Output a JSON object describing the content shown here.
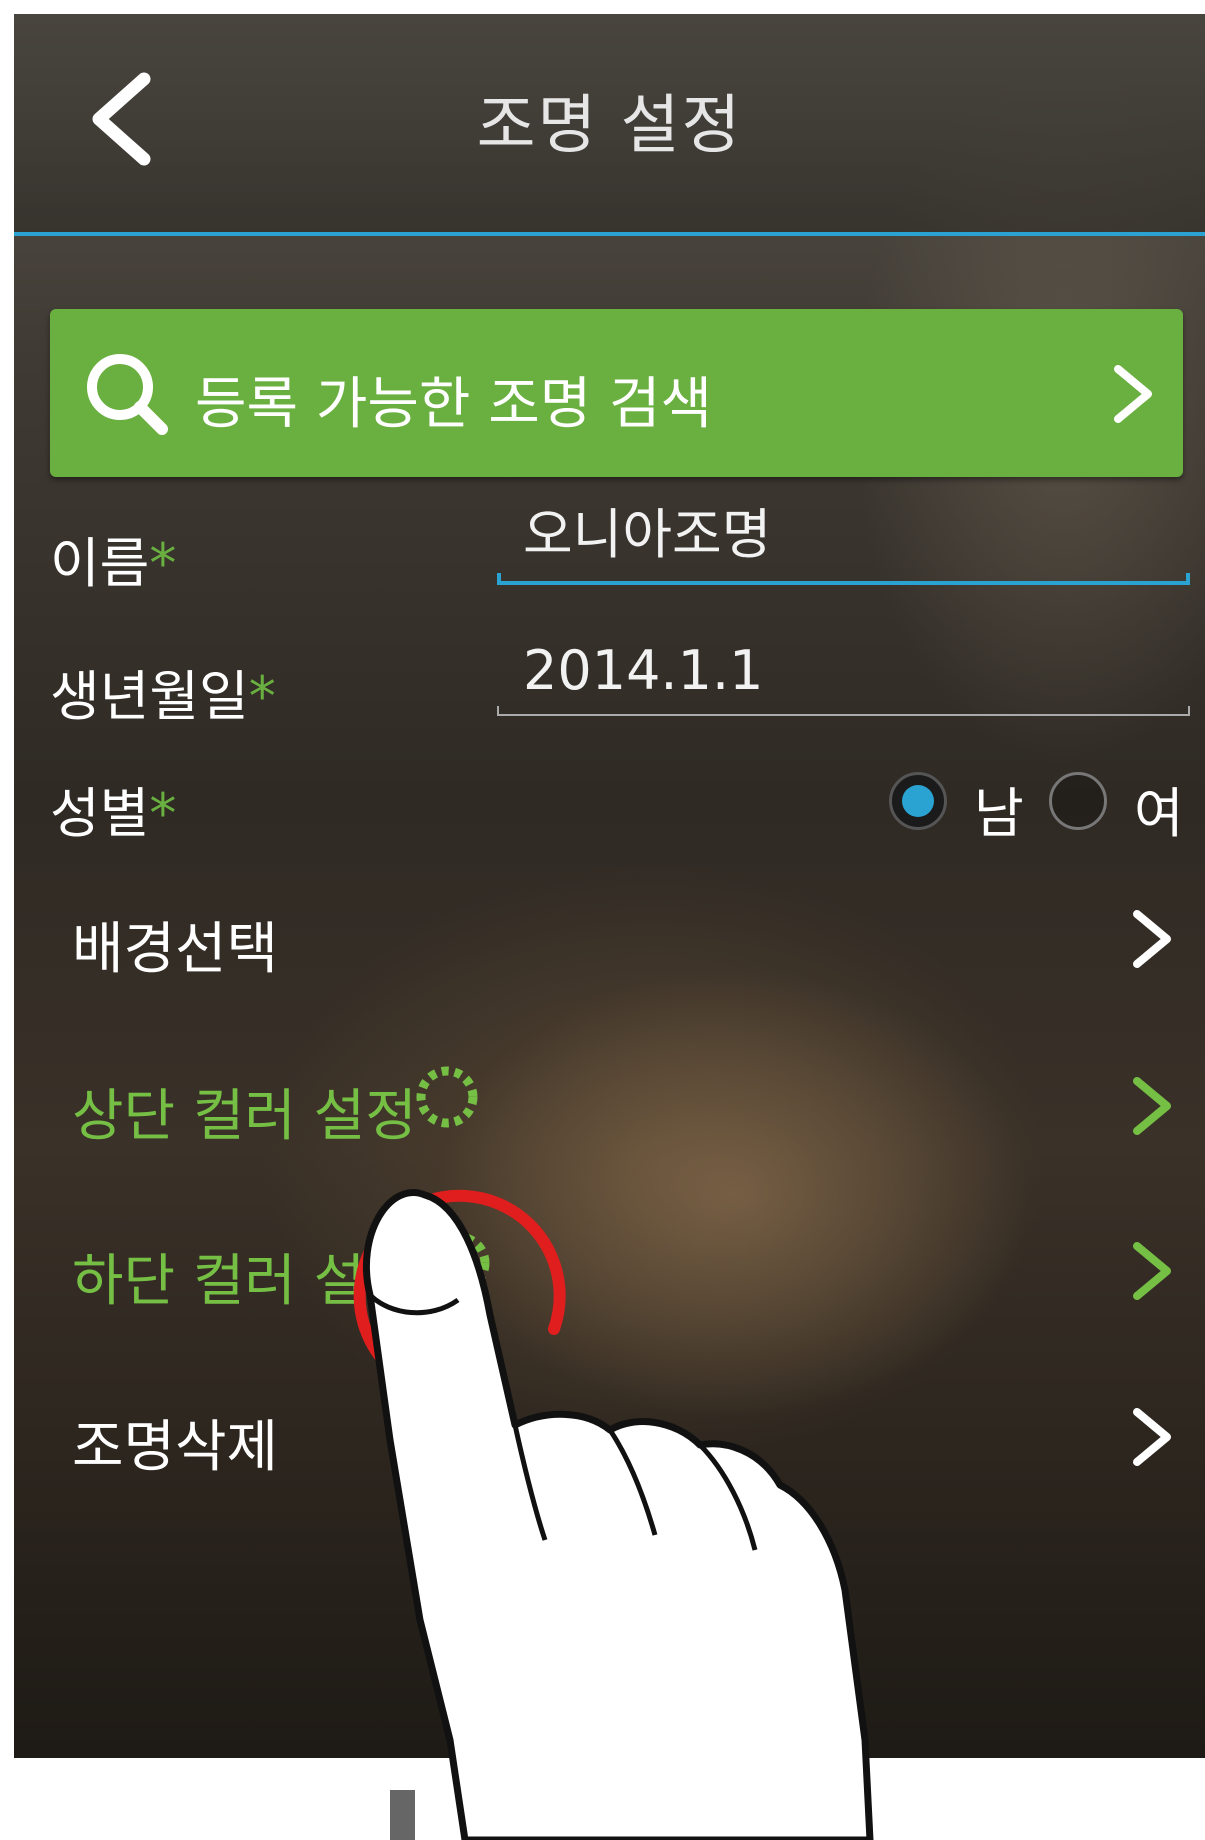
{
  "header": {
    "title": "조명 설정",
    "back_icon": "chevron-left-icon"
  },
  "search": {
    "label": "등록 가능한 조명 검색",
    "icon": "search-icon",
    "chevron": "chevron-right-icon"
  },
  "form": {
    "name_label": "이름",
    "name_value": "오니아조명",
    "birth_label": "생년월일",
    "birth_value": "2014.1.1",
    "gender_label": "성별",
    "gender_male": "남",
    "gender_female": "여",
    "gender_selected": "남",
    "required_mark": "*"
  },
  "menu": {
    "background": "배경선택",
    "top_color": "상단 컬러 설정",
    "bottom_color": "하단 컬러 설정",
    "delete": "조명삭제"
  },
  "colors": {
    "accent_blue": "#2aa3d3",
    "accent_green": "#6ab040",
    "tap_highlight": "#e01e1e"
  }
}
